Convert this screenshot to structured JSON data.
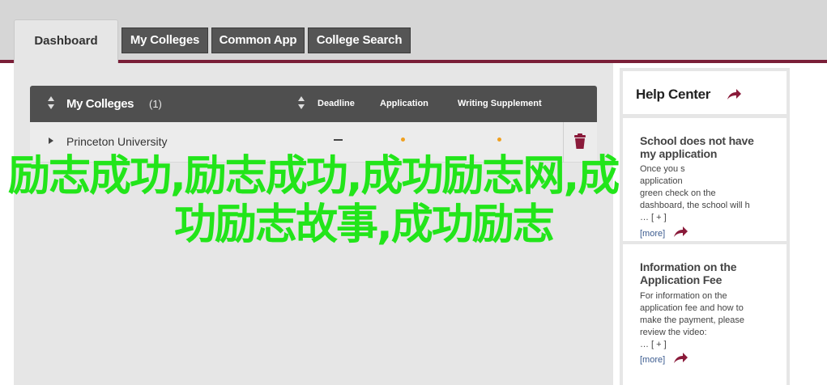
{
  "tabs": {
    "active": "Dashboard",
    "items": [
      "My Colleges",
      "Common App",
      "College Search"
    ]
  },
  "table": {
    "title": "My Colleges",
    "count": "(1)",
    "columns": [
      "Deadline",
      "Application",
      "Writing Supplement"
    ],
    "rows": [
      {
        "name": "Princeton University",
        "deadline": "—"
      }
    ]
  },
  "help": {
    "title": "Help Center",
    "cards": [
      {
        "title_lines": [
          "School does not have",
          "my application"
        ],
        "body_lines": [
          "Once you s",
          "application",
          "green check on the",
          "dashboard, the school will h"
        ],
        "toggle": "… [ + ]",
        "more": "[more]"
      },
      {
        "title_lines": [
          "Information on the",
          "Application Fee"
        ],
        "body_lines": [
          "For information on the",
          "application fee and how to",
          "make the payment, please",
          "review the video:"
        ],
        "toggle": "… [ + ]",
        "more": "[more]"
      }
    ]
  },
  "overlay": {
    "line1": "励志成功,励志成功,成功励志网,成",
    "line2": "功励志故事,成功励志"
  },
  "colors": {
    "accent": "#7a1f38",
    "overlay_text": "#22e51a",
    "status_dot": "#f0a020",
    "link": "#3b5b8f"
  }
}
